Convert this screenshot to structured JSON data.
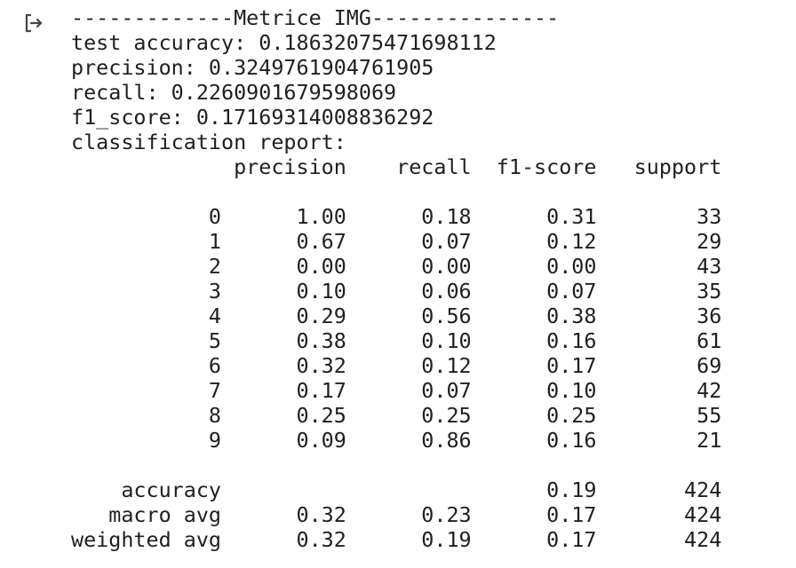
{
  "cell": {
    "output_icon": "output-arrow-icon"
  },
  "output": {
    "header": "-------------Metrice IMG---------------",
    "test_accuracy": "test accuracy: 0.18632075471698112",
    "precision": "precision: 0.3249761904761905",
    "recall": "recall: 0.2260901679598069",
    "f1_score": "f1_score: 0.17169314008836292",
    "report_title": "classification report:",
    "report": {
      "columns": [
        "precision",
        "recall",
        "f1-score",
        "support"
      ],
      "rows": [
        {
          "label": "0",
          "precision": "1.00",
          "recall": "0.18",
          "f1": "0.31",
          "support": "33"
        },
        {
          "label": "1",
          "precision": "0.67",
          "recall": "0.07",
          "f1": "0.12",
          "support": "29"
        },
        {
          "label": "2",
          "precision": "0.00",
          "recall": "0.00",
          "f1": "0.00",
          "support": "43"
        },
        {
          "label": "3",
          "precision": "0.10",
          "recall": "0.06",
          "f1": "0.07",
          "support": "35"
        },
        {
          "label": "4",
          "precision": "0.29",
          "recall": "0.56",
          "f1": "0.38",
          "support": "36"
        },
        {
          "label": "5",
          "precision": "0.38",
          "recall": "0.10",
          "f1": "0.16",
          "support": "61"
        },
        {
          "label": "6",
          "precision": "0.32",
          "recall": "0.12",
          "f1": "0.17",
          "support": "69"
        },
        {
          "label": "7",
          "precision": "0.17",
          "recall": "0.07",
          "f1": "0.10",
          "support": "42"
        },
        {
          "label": "8",
          "precision": "0.25",
          "recall": "0.25",
          "f1": "0.25",
          "support": "55"
        },
        {
          "label": "9",
          "precision": "0.09",
          "recall": "0.86",
          "f1": "0.16",
          "support": "21"
        }
      ],
      "summary": [
        {
          "label": "accuracy",
          "precision": "",
          "recall": "",
          "f1": "0.19",
          "support": "424"
        },
        {
          "label": "macro avg",
          "precision": "0.32",
          "recall": "0.23",
          "f1": "0.17",
          "support": "424"
        },
        {
          "label": "weighted avg",
          "precision": "0.32",
          "recall": "0.19",
          "f1": "0.17",
          "support": "424"
        }
      ]
    }
  }
}
